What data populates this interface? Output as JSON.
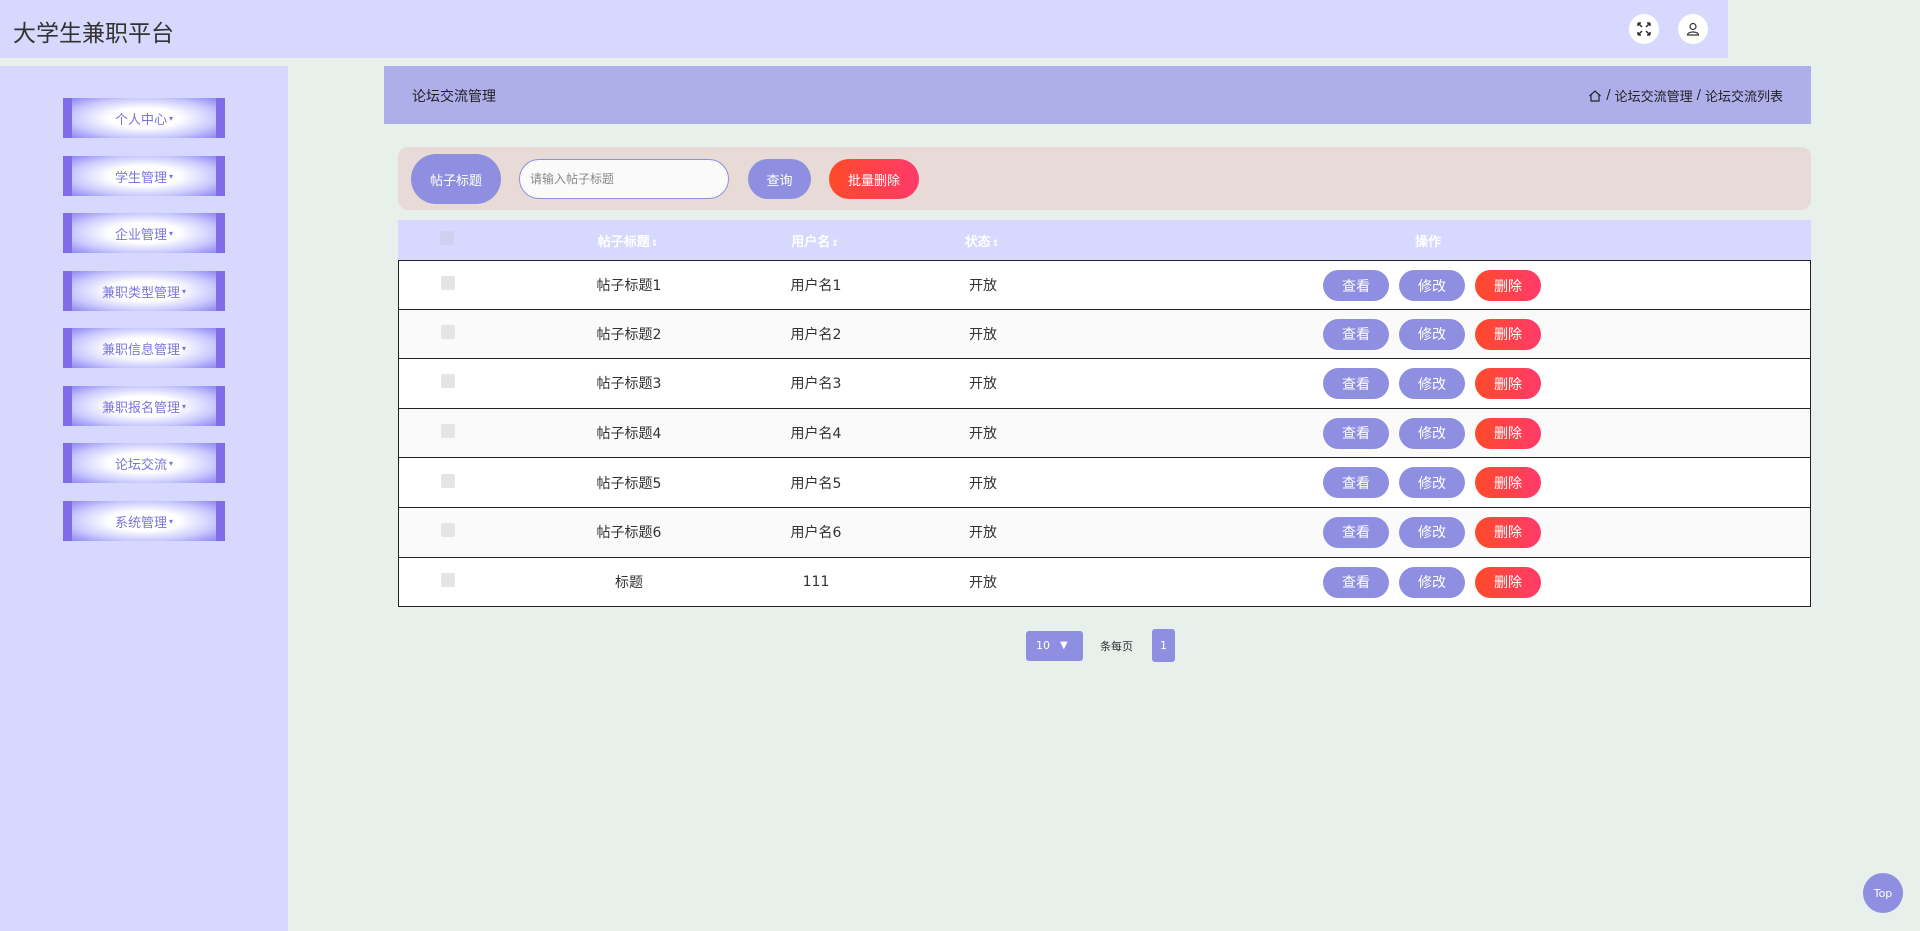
{
  "app": {
    "title": "大学生兼职平台"
  },
  "header": {
    "fullscreen_icon": "fullscreen-icon",
    "user_icon": "user-icon"
  },
  "sidebar": {
    "items": [
      {
        "label": "个人中心"
      },
      {
        "label": "学生管理"
      },
      {
        "label": "企业管理"
      },
      {
        "label": "兼职类型管理"
      },
      {
        "label": "兼职信息管理"
      },
      {
        "label": "兼职报名管理"
      },
      {
        "label": "论坛交流"
      },
      {
        "label": "系统管理"
      }
    ],
    "caret": "▾"
  },
  "page": {
    "title": "论坛交流管理",
    "breadcrumb": [
      "论坛交流管理",
      "论坛交流列表"
    ],
    "breadcrumb_sep": "/"
  },
  "search": {
    "label": "帖子标题",
    "placeholder": "请输入帖子标题",
    "value": "",
    "query_label": "查询",
    "batch_delete_label": "批量删除"
  },
  "table": {
    "headers": {
      "title": "帖子标题",
      "user": "用户名",
      "status": "状态",
      "ops": "操作",
      "sort_icon": "⇕"
    },
    "rows": [
      {
        "title": "帖子标题1",
        "user": "用户名1",
        "status": "开放"
      },
      {
        "title": "帖子标题2",
        "user": "用户名2",
        "status": "开放"
      },
      {
        "title": "帖子标题3",
        "user": "用户名3",
        "status": "开放"
      },
      {
        "title": "帖子标题4",
        "user": "用户名4",
        "status": "开放"
      },
      {
        "title": "帖子标题5",
        "user": "用户名5",
        "status": "开放"
      },
      {
        "title": "帖子标题6",
        "user": "用户名6",
        "status": "开放"
      },
      {
        "title": "标题",
        "user": "111",
        "status": "开放"
      }
    ],
    "actions": {
      "view": "查看",
      "edit": "修改",
      "delete": "删除"
    }
  },
  "pagination": {
    "page_size": "10",
    "per_page_label": "条每页",
    "current_page": "1"
  },
  "top_button": {
    "label": "Top"
  },
  "colors": {
    "header_bg": "#d6d8fd",
    "content_header_bg": "#adaeea",
    "accent": "#8e8fe0",
    "danger": "#ff4a2a",
    "search_bar_bg": "#e8dbd7",
    "page_bg": "#e8f0ec"
  }
}
